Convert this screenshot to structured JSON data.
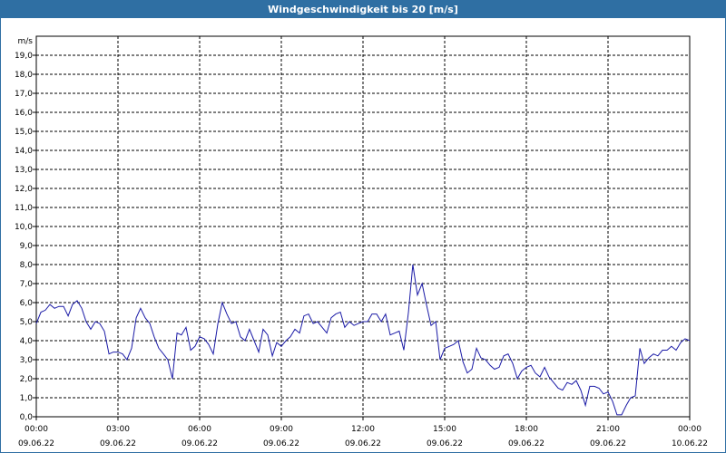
{
  "window": {
    "title": "Windgeschwindigkeit bis 20 [m/s]"
  },
  "chart_data": {
    "type": "line",
    "title": "Windgeschwindigkeit bis 20 [m/s]",
    "ylabel": "m/s",
    "ylim": [
      0,
      20
    ],
    "y_ticks": [
      "0,0",
      "1,0",
      "2,0",
      "3,0",
      "4,0",
      "5,0",
      "6,0",
      "7,0",
      "8,0",
      "9,0",
      "10,0",
      "11,0",
      "12,0",
      "13,0",
      "14,0",
      "15,0",
      "16,0",
      "17,0",
      "18,0",
      "19,0"
    ],
    "x_ticks": [
      {
        "hour": 0,
        "time": "00:00",
        "date": "09.06.22"
      },
      {
        "hour": 3,
        "time": "03:00",
        "date": "09.06.22"
      },
      {
        "hour": 6,
        "time": "06:00",
        "date": "09.06.22"
      },
      {
        "hour": 9,
        "time": "09:00",
        "date": "09.06.22"
      },
      {
        "hour": 12,
        "time": "12:00",
        "date": "09.06.22"
      },
      {
        "hour": 15,
        "time": "15:00",
        "date": "09.06.22"
      },
      {
        "hour": 18,
        "time": "18:00",
        "date": "09.06.22"
      },
      {
        "hour": 21,
        "time": "21:00",
        "date": "09.06.22"
      },
      {
        "hour": 24,
        "time": "00:00",
        "date": "10.06.22"
      }
    ],
    "xlim": [
      0,
      24
    ],
    "grid": true,
    "line_color": "#1a1aa6",
    "series": [
      {
        "x": [
          0,
          0.17,
          0.33,
          0.5,
          0.67,
          0.83,
          1.0,
          1.17,
          1.33,
          1.5,
          1.67,
          1.83,
          2.0,
          2.17,
          2.33,
          2.5,
          2.67,
          2.83,
          3.0,
          3.17,
          3.33,
          3.5,
          3.67,
          3.83,
          4.0,
          4.17,
          4.33,
          4.5,
          4.67,
          4.83,
          5.0,
          5.17,
          5.33,
          5.5,
          5.67,
          5.83,
          6.0,
          6.17,
          6.33,
          6.5,
          6.67,
          6.83,
          7.0,
          7.17,
          7.33,
          7.5,
          7.67,
          7.83,
          8.0,
          8.17,
          8.33,
          8.5,
          8.67,
          8.83,
          9.0,
          9.17,
          9.33,
          9.5,
          9.67,
          9.83,
          10.0,
          10.17,
          10.33,
          10.5,
          10.67,
          10.83,
          11.0,
          11.17,
          11.33,
          11.5,
          11.67,
          11.83,
          12.0,
          12.17,
          12.33,
          12.5,
          12.67,
          12.83,
          13.0,
          13.17,
          13.33,
          13.5,
          13.67,
          13.83,
          14.0,
          14.17,
          14.33,
          14.5,
          14.67,
          14.83,
          15.0,
          15.17,
          15.33,
          15.5,
          15.67,
          15.83,
          16.0,
          16.17,
          16.33,
          16.5,
          16.67,
          16.83,
          17.0,
          17.17,
          17.33,
          17.5,
          17.67,
          17.83,
          18.0,
          18.17,
          18.33,
          18.5,
          18.67,
          18.83,
          19.0,
          19.17,
          19.33,
          19.5,
          19.67,
          19.83,
          20.0,
          20.17,
          20.33,
          20.5,
          20.67,
          20.83,
          21.0,
          21.17,
          21.33,
          21.5,
          21.67,
          21.83,
          22.0,
          22.17,
          22.33,
          22.5,
          22.67,
          22.83,
          23.0,
          23.17,
          23.33,
          23.5,
          23.67,
          23.83,
          24.0
        ],
        "values": [
          4.9,
          5.5,
          5.6,
          5.9,
          5.7,
          5.8,
          5.8,
          5.3,
          5.9,
          6.1,
          5.7,
          5.0,
          4.6,
          5.0,
          4.9,
          4.5,
          3.3,
          3.4,
          3.4,
          3.3,
          3.0,
          3.6,
          5.2,
          5.7,
          5.2,
          4.9,
          4.2,
          3.6,
          3.3,
          3.0,
          2.0,
          4.4,
          4.3,
          4.7,
          3.5,
          3.7,
          4.2,
          4.1,
          3.8,
          3.3,
          4.9,
          6.0,
          5.4,
          4.9,
          5.0,
          4.2,
          4.0,
          4.6,
          4.0,
          3.4,
          4.6,
          4.3,
          3.2,
          3.9,
          3.7,
          4.0,
          4.2,
          4.6,
          4.4,
          5.3,
          5.4,
          4.9,
          5.0,
          4.7,
          4.4,
          5.2,
          5.4,
          5.5,
          4.7,
          5.0,
          4.8,
          4.9,
          5.0,
          5.0,
          5.4,
          5.4,
          5.0,
          5.4,
          4.3,
          4.4,
          4.5,
          3.5,
          5.5,
          8.0,
          6.4,
          7.0,
          5.9,
          4.8,
          5.0,
          3.0,
          3.6,
          3.7,
          3.8,
          4.0,
          2.9,
          2.3,
          2.5,
          3.6,
          3.1,
          3.0,
          2.7,
          2.5,
          2.6,
          3.2,
          3.3,
          2.8,
          2.0,
          2.4,
          2.6,
          2.7,
          2.3,
          2.1,
          2.6,
          2.1,
          1.8,
          1.5,
          1.4,
          1.8,
          1.7,
          1.9,
          1.4,
          0.6,
          1.6,
          1.6,
          1.5,
          1.2,
          1.3,
          0.8,
          0.1,
          0.1,
          0.6,
          1.0,
          1.1,
          3.6,
          2.8,
          3.1,
          3.3,
          3.2,
          3.5,
          3.5,
          3.7,
          3.5,
          3.9,
          4.1,
          4.0
        ]
      }
    ]
  }
}
